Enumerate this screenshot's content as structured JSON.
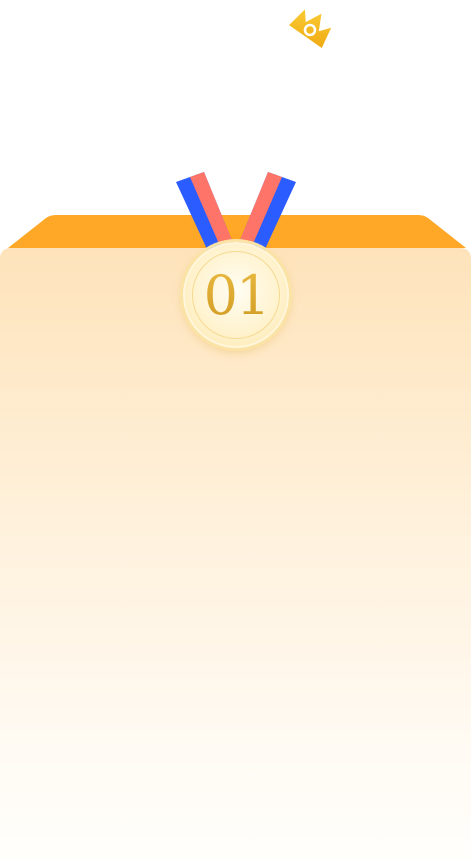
{
  "medal": {
    "rank": "01"
  },
  "icons": {
    "crown": "crown-icon",
    "ribbon": "ribbon-icon",
    "medal": "medal-icon"
  },
  "colors": {
    "podium_top": "#ffa726",
    "podium_body_top": "#fee3ba",
    "podium_body_bottom": "#fffefb",
    "ribbon_blue": "#2b5cff",
    "ribbon_red": "#ff7468",
    "crown": "#f5b91e",
    "medal_text": "#dcaa2b"
  }
}
